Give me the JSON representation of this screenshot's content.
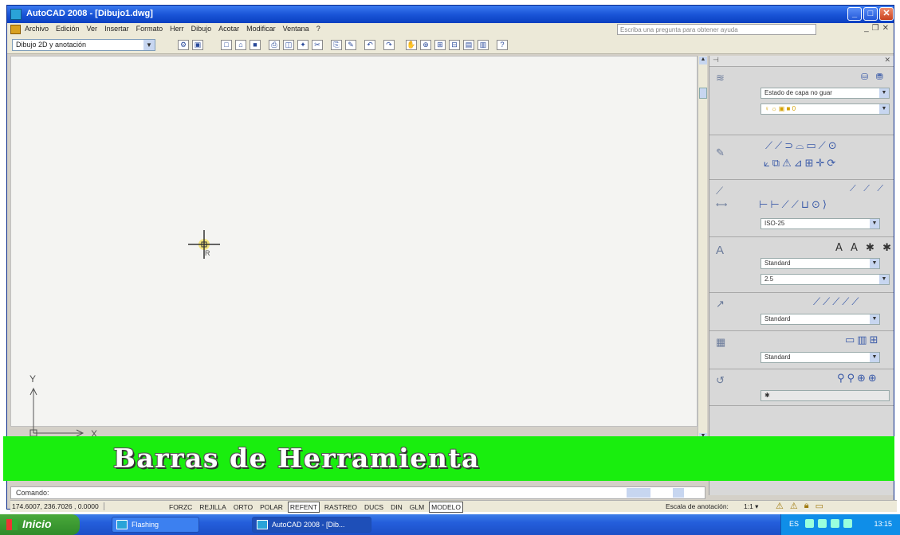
{
  "window": {
    "title": "AutoCAD 2008 - [Dibujo1.dwg]"
  },
  "menubar": {
    "items": [
      "Archivo",
      "Edición",
      "Ver",
      "Insertar",
      "Formato",
      "Herr",
      "Dibujo",
      "Acotar",
      "Modificar",
      "Ventana",
      "?"
    ],
    "help_search": "Escriba una pregunta para obtener ayuda"
  },
  "toolbar": {
    "workspace": "Dibujo 2D y anotación"
  },
  "panel": {
    "layers": {
      "layer_state": "Estado de capa no guar"
    },
    "dimensions": {
      "dim_style": "ISO-25"
    },
    "text": {
      "text_style": "Standard",
      "text_height": "2.5"
    },
    "multileader": {
      "style": "Standard"
    },
    "tables": {
      "style": "Standard"
    }
  },
  "banner": {
    "text": "Barras de Herramienta"
  },
  "command": {
    "label": "Comando:"
  },
  "statusbar": {
    "coords": "174.6007, 236.7026 , 0.0000",
    "toggles": [
      {
        "label": "FORZC",
        "on": false
      },
      {
        "label": "REJILLA",
        "on": false
      },
      {
        "label": "ORTO",
        "on": false
      },
      {
        "label": "POLAR",
        "on": false
      },
      {
        "label": "REFENT",
        "on": true
      },
      {
        "label": "RASTREO",
        "on": false
      },
      {
        "label": "DUCS",
        "on": false
      },
      {
        "label": "DIN",
        "on": false
      },
      {
        "label": "GLM",
        "on": false
      },
      {
        "label": "MODELO",
        "on": true
      }
    ],
    "annotation_label": "Escala de anotación:",
    "annotation_value": "1:1 ▾"
  },
  "taskbar": {
    "start": "Inicio",
    "tasks": [
      "Flashing",
      "AutoCAD 2008 - [Dib..."
    ],
    "lang": "ES",
    "clock": "13:15"
  },
  "ucs": {
    "x_label": "X",
    "y_label": "Y"
  }
}
